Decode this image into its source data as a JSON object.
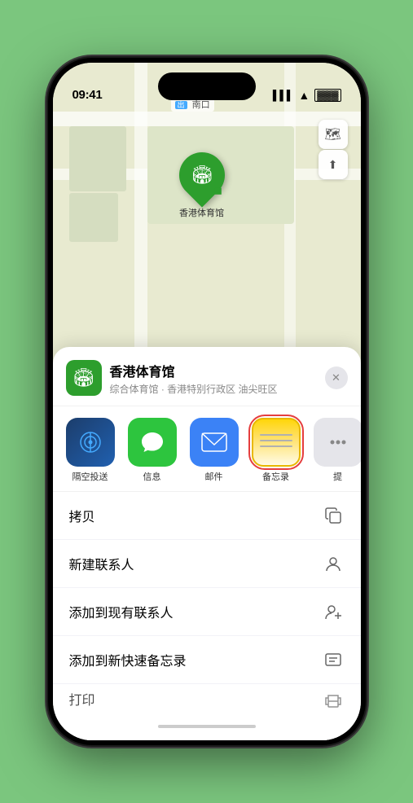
{
  "statusBar": {
    "time": "09:41",
    "location_icon": "▶"
  },
  "map": {
    "northLabel": "南口",
    "controls": {
      "map_icon": "🗺",
      "location_icon": "⬆"
    }
  },
  "pin": {
    "label": "香港体育馆"
  },
  "sheet": {
    "venueName": "香港体育馆",
    "venueDesc": "综合体育馆 · 香港特别行政区 油尖旺区",
    "closeLabel": "✕"
  },
  "apps": [
    {
      "id": "airdrop",
      "label": "隔空投送"
    },
    {
      "id": "messages",
      "label": "信息"
    },
    {
      "id": "mail",
      "label": "邮件"
    },
    {
      "id": "notes",
      "label": "备忘录",
      "selected": true
    },
    {
      "id": "more",
      "label": "提"
    }
  ],
  "actions": [
    {
      "label": "拷贝",
      "icon": "⎘"
    },
    {
      "label": "新建联系人",
      "icon": "👤"
    },
    {
      "label": "添加到现有联系人",
      "icon": "👤+"
    },
    {
      "label": "添加到新快速备忘录",
      "icon": "📋"
    },
    {
      "label": "打印",
      "icon": "🖨"
    }
  ]
}
